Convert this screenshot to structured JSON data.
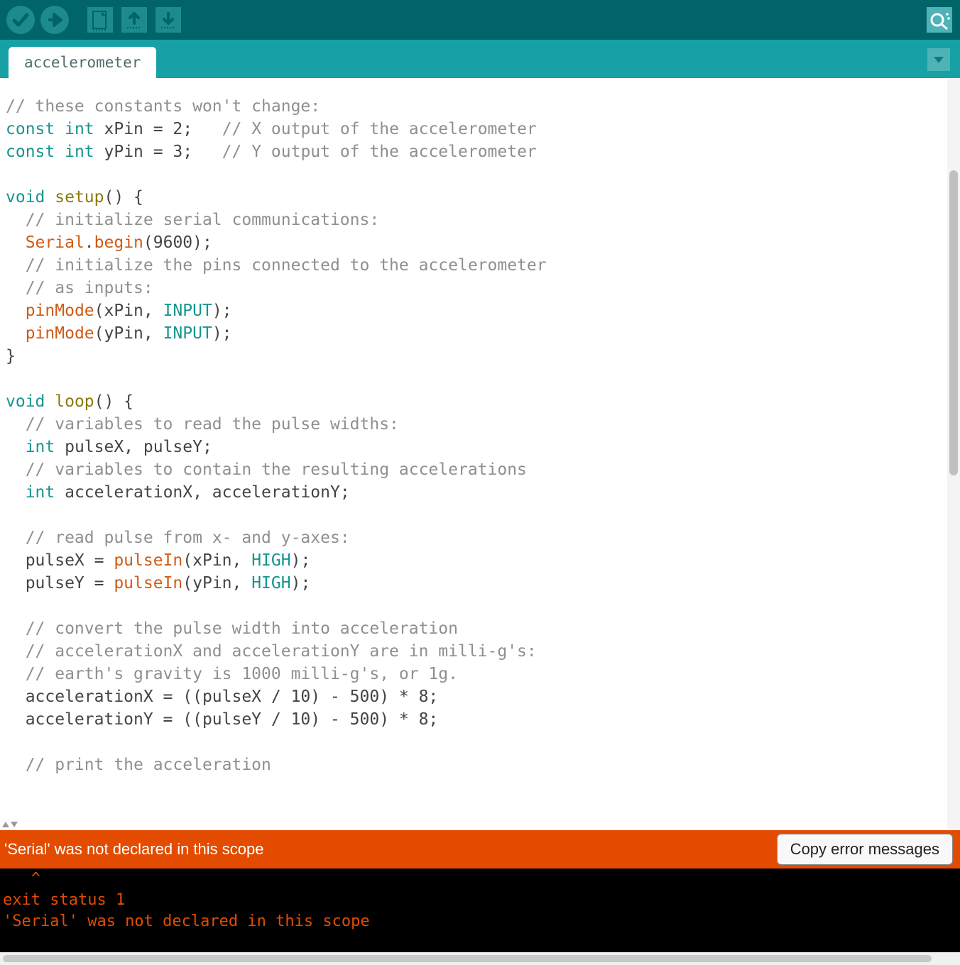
{
  "tab_title": "accelerometer",
  "error_summary": "'Serial' was not declared in this scope",
  "copy_btn_label": "Copy error messages",
  "console_text": "   ^\nexit status 1\n'Serial' was not declared in this scope\n",
  "code": {
    "l1": "// these constants won't change:",
    "l2a": "const",
    "l2b": "int",
    "l2c": " xPin = 2;   ",
    "l2d": "// X output of the accelerometer",
    "l3a": "const",
    "l3b": "int",
    "l3c": " yPin = 3;   ",
    "l3d": "// Y output of the accelerometer",
    "l5a": "void",
    "l5b": "setup",
    "l5c": "() {",
    "l6": "  // initialize serial communications:",
    "l7a": "Serial",
    "l7b": ".",
    "l7c": "begin",
    "l7d": "(9600);",
    "l8": "  // initialize the pins connected to the accelerometer",
    "l9": "  // as inputs:",
    "l10a": "pinMode",
    "l10b": "(xPin, ",
    "l10c": "INPUT",
    "l10d": ");",
    "l11a": "pinMode",
    "l11b": "(yPin, ",
    "l11c": "INPUT",
    "l11d": ");",
    "l12": "}",
    "l14a": "void",
    "l14b": "loop",
    "l14c": "() {",
    "l15": "  // variables to read the pulse widths:",
    "l16a": "int",
    "l16b": " pulseX, pulseY;",
    "l17": "  // variables to contain the resulting accelerations",
    "l18a": "int",
    "l18b": " accelerationX, accelerationY;",
    "l20": "  // read pulse from x- and y-axes:",
    "l21a": "  pulseX = ",
    "l21b": "pulseIn",
    "l21c": "(xPin, ",
    "l21d": "HIGH",
    "l21e": ");",
    "l22a": "  pulseY = ",
    "l22b": "pulseIn",
    "l22c": "(yPin, ",
    "l22d": "HIGH",
    "l22e": ");",
    "l24": "  // convert the pulse width into acceleration",
    "l25": "  // accelerationX and accelerationY are in milli-g's:",
    "l26": "  // earth's gravity is 1000 milli-g's, or 1g.",
    "l27": "  accelerationX = ((pulseX / 10) - 500) * 8;",
    "l28": "  accelerationY = ((pulseY / 10) - 500) * 8;",
    "l30": "  // print the acceleration"
  }
}
